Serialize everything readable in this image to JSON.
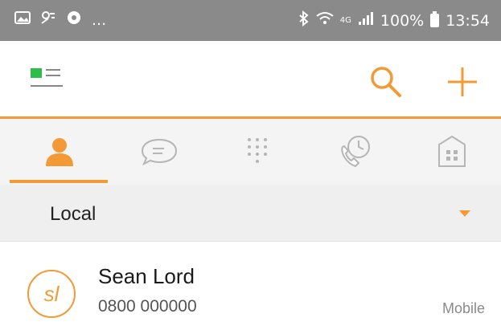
{
  "status_bar": {
    "left_ellipsis": "...",
    "battery": "100%",
    "time": "13:54",
    "signal_label": "4G"
  },
  "app_bar": {
    "menu_icon": "menu-icon",
    "search_icon": "search-icon",
    "add_icon": "plus-icon",
    "accent_color": "#f39a36"
  },
  "tabs": [
    {
      "icon": "contacts-icon",
      "active": true
    },
    {
      "icon": "messages-icon",
      "active": false
    },
    {
      "icon": "dialpad-icon",
      "active": false
    },
    {
      "icon": "call-history-icon",
      "active": false
    },
    {
      "icon": "company-directory-icon",
      "active": false
    }
  ],
  "filter": {
    "label": "Local"
  },
  "contacts": [
    {
      "initials": "sl",
      "name": "Sean Lord",
      "number": "0800 000000",
      "type": "Mobile"
    }
  ]
}
